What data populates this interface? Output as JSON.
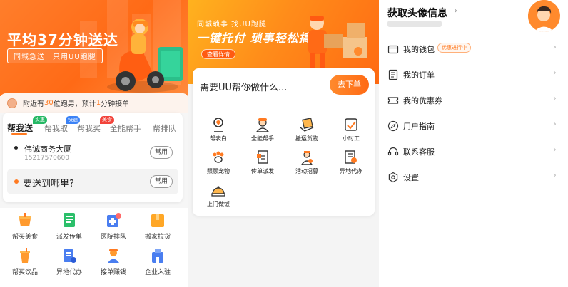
{
  "panel1": {
    "banner": {
      "title": "平均37分钟送达",
      "subtitle": "同城急送　只用UU跑腿"
    },
    "notice": {
      "prefix": "附近有 ",
      "count": "30",
      "mid": " 位跑男，预计 ",
      "minutes": "1",
      "suffix": " 分钟接单"
    },
    "tabs": [
      {
        "label": "帮我送",
        "tag": "实惠",
        "tag_color": "#25b864"
      },
      {
        "label": "帮我取",
        "tag": "快速",
        "tag_color": "#3b82f6"
      },
      {
        "label": "帮我买",
        "tag": "美食",
        "tag_color": "#f2433a"
      },
      {
        "label": "全能帮手"
      },
      {
        "label": "帮排队"
      }
    ],
    "address": {
      "name": "伟诚商务大厦",
      "phone": "15217570600",
      "common_label": "常用"
    },
    "destination": {
      "placeholder": "要送到哪里?",
      "common_label": "常用"
    },
    "services": [
      {
        "label": "帮买美食",
        "icon": "food-icon"
      },
      {
        "label": "派发传单",
        "icon": "flyer-icon"
      },
      {
        "label": "医院排队",
        "icon": "hospital-icon"
      },
      {
        "label": "搬家拉货",
        "icon": "moving-icon"
      },
      {
        "label": "帮买饮品",
        "icon": "drink-icon"
      },
      {
        "label": "异地代办",
        "icon": "remote-errand-icon"
      },
      {
        "label": "接单赚钱",
        "icon": "earn-money-icon"
      },
      {
        "label": "企业入驻",
        "icon": "enterprise-icon"
      }
    ]
  },
  "panel2": {
    "banner": {
      "small": "同城琐事 找UU跑腿",
      "big": "一键托付 琐事轻松搞定",
      "button": "查看详情"
    },
    "question": "需要UU帮你做什么...",
    "order_button": "去下单",
    "services": [
      {
        "label": "帮表白",
        "icon": "confess-icon"
      },
      {
        "label": "全能帮手",
        "icon": "all-round-helper-icon"
      },
      {
        "label": "搬运货物",
        "icon": "carry-goods-icon"
      },
      {
        "label": "小时工",
        "icon": "hourly-worker-icon"
      },
      {
        "label": "照顾宠物",
        "icon": "pet-care-icon"
      },
      {
        "label": "传单派发",
        "icon": "flyer-distribute-icon"
      },
      {
        "label": "活动招募",
        "icon": "event-recruit-icon"
      },
      {
        "label": "异地代办",
        "icon": "remote-errand-icon"
      },
      {
        "label": "上门做饭",
        "icon": "home-cooking-icon"
      }
    ]
  },
  "panel3": {
    "title": "获取头像信息",
    "menu": [
      {
        "label": "我的钱包",
        "icon": "wallet-icon",
        "badge": "优惠进行中"
      },
      {
        "label": "我的订单",
        "icon": "order-icon"
      },
      {
        "label": "我的优惠券",
        "icon": "coupon-icon"
      },
      {
        "label": "用户指南",
        "icon": "compass-icon"
      },
      {
        "label": "联系客服",
        "icon": "headset-icon"
      },
      {
        "label": "设置",
        "icon": "settings-icon"
      }
    ]
  },
  "colors": {
    "accent": "#ff7a21",
    "text": "#222222",
    "muted": "#999999"
  }
}
